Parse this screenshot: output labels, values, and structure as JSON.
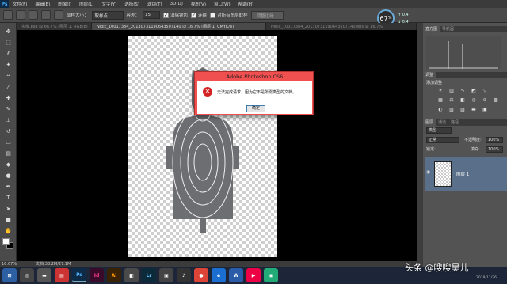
{
  "app": {
    "logo": "Ps",
    "menu": [
      "文件(F)",
      "编辑(E)",
      "图像(I)",
      "图层(L)",
      "文字(Y)",
      "选择(S)",
      "滤镜(T)",
      "3D(D)",
      "视图(V)",
      "窗口(W)",
      "帮助(H)"
    ]
  },
  "options": {
    "size_label": "取样大小：",
    "size_value": "取样点",
    "tolerance_label": "容差：",
    "tolerance_value": "15",
    "antialias_label": "消除锯齿",
    "contiguous_label": "连续",
    "all_layers_label": "对所有图层取样",
    "refine_button": "调整边缘..."
  },
  "perf": {
    "timer": "67",
    "timer_unit": "%",
    "up": "0.4",
    "down": "0.4"
  },
  "tabs": [
    "头像.psd @ 66.7% (图层 1, RGB/8)",
    "Nipic_10017384_20130731190643507140 @ 16.7% (图层 1, CMYK/8)",
    "Nipic_10017384_20130731190643507140.eps @ 16.7%"
  ],
  "dialog": {
    "title": "Adobe Photoshop CS6",
    "message": "无法完成请求，因为它不是所需类型的文档。",
    "ok": "确定",
    "icon": "error-icon"
  },
  "status": {
    "zoom": "16.67%",
    "doc": "文档:33.2M/27.1M"
  },
  "panels": {
    "histogram_tabs": [
      "直方图",
      "导航器"
    ],
    "adjust_tab": "调整",
    "adjust_title": "添加调整",
    "layers_tabs": [
      "图层",
      "通道",
      "路径"
    ],
    "kind": "类型",
    "blend_mode": "正常",
    "opacity_label": "不透明度:",
    "opacity_value": "100%",
    "lock_label": "锁定:",
    "fill_label": "填充:",
    "fill_value": "100%",
    "layer_name": "图层 1"
  },
  "taskbar": {
    "watermark": "头条 @嗖嗖昊儿",
    "date": "2019/11/26"
  },
  "colors": {
    "dialog_frame": "#f05050",
    "target": "#6d6e72",
    "layer_selected": "#5a6f8a",
    "ps_blue": "#4fb2ff"
  }
}
